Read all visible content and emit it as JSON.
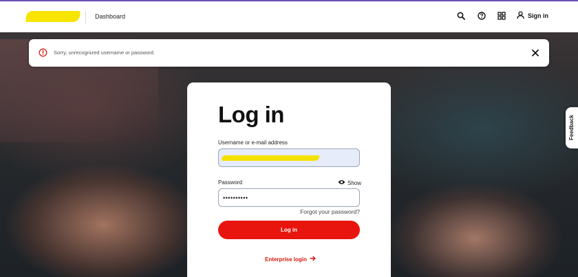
{
  "header": {
    "nav_dashboard": "Dashboard",
    "sign_in": "Sign in",
    "icons": [
      "search-icon",
      "help-icon",
      "apps-grid-icon",
      "user-icon"
    ]
  },
  "alert": {
    "message": "Sorry, unrecognized username or password.",
    "icon": "error-icon",
    "close_icon": "close-icon",
    "color": "#d32a1f"
  },
  "login": {
    "title": "Log in",
    "username_label": "Username or e-mail address",
    "password_label": "Password",
    "password_value": "••••••••••",
    "show_label": "Show",
    "forgot_label": "Forgot your password?",
    "submit_label": "Log in",
    "enterprise_label": "Enterprise login",
    "accent_color": "#e8150e"
  },
  "feedback": {
    "label": "Feedback"
  }
}
